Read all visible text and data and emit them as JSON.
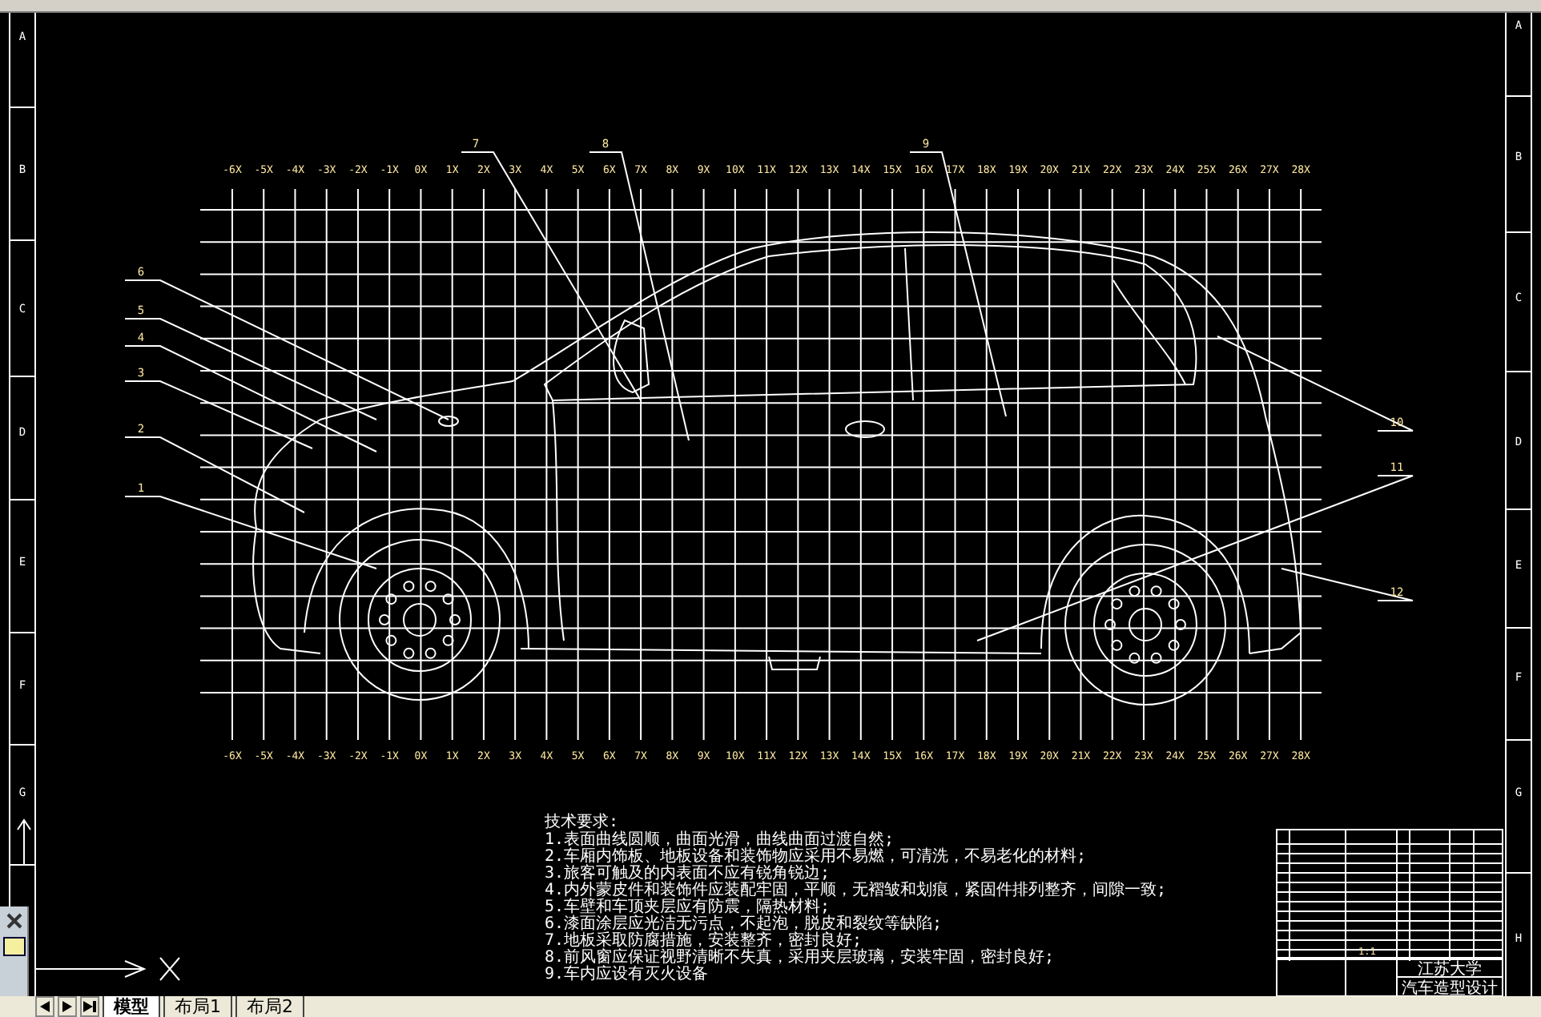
{
  "border_letters_left": [
    "A",
    "B",
    "C",
    "D",
    "E",
    "F",
    "G"
  ],
  "border_letters_right": [
    "A",
    "B",
    "C",
    "D",
    "E",
    "F",
    "G",
    "H"
  ],
  "grid_labels_top": [
    "-6X",
    "-5X",
    "-4X",
    "-3X",
    "-2X",
    "-1X",
    "0X",
    "1X",
    "2X",
    "3X",
    "4X",
    "5X",
    "6X",
    "7X",
    "8X",
    "9X",
    "10X",
    "11X",
    "12X",
    "13X",
    "14X",
    "15X",
    "16X",
    "17X",
    "18X",
    "19X",
    "20X",
    "21X",
    "22X",
    "23X",
    "24X",
    "25X",
    "26X",
    "27X",
    "28X"
  ],
  "grid_labels_bottom": [
    "-6X",
    "-5X",
    "-4X",
    "-3X",
    "-2X",
    "-1X",
    "0X",
    "1X",
    "2X",
    "3X",
    "4X",
    "5X",
    "6X",
    "7X",
    "8X",
    "9X",
    "10X",
    "11X",
    "12X",
    "13X",
    "14X",
    "15X",
    "16X",
    "17X",
    "18X",
    "19X",
    "20X",
    "21X",
    "22X",
    "23X",
    "24X",
    "25X",
    "26X",
    "27X",
    "28X"
  ],
  "callouts": [
    {
      "label": "7"
    },
    {
      "label": "8"
    },
    {
      "label": "9"
    },
    {
      "label": "6"
    },
    {
      "label": "5"
    },
    {
      "label": "4"
    },
    {
      "label": "3"
    },
    {
      "label": "10"
    },
    {
      "label": "2"
    },
    {
      "label": "11"
    },
    {
      "label": "1"
    },
    {
      "label": "12"
    }
  ],
  "notes": {
    "title": "技术要求:",
    "lines": [
      "1.表面曲线圆顺，曲面光滑，曲线曲面过渡自然;",
      "2.车厢内饰板、地板设备和装饰物应采用不易燃，可清洗，不易老化的材料;",
      "3.旅客可触及的内表面不应有锐角锐边;",
      "4.内外蒙皮件和装饰件应装配牢固，平顺，无褶皱和划痕，紧固件排列整齐，间隙一致;",
      "5.车壁和车顶夹层应有防震，隔热材料;",
      "6.漆面涂层应光洁无污点，不起泡，脱皮和裂纹等缺陷;",
      "7.地板采取防腐措施，安装整齐，密封良好;",
      "8.前风窗应保证视野清晰不失真，采用夹层玻璃，安装牢固，密封良好;",
      "9.车内应设有灭火设备"
    ]
  },
  "title_block": {
    "scale": "1:1",
    "school": "江苏大学",
    "drawing_name": "汽车造型设计"
  },
  "tabs": [
    {
      "label": "模型",
      "selected": true
    },
    {
      "label": "布局1",
      "selected": false
    },
    {
      "label": "布局2",
      "selected": false
    }
  ]
}
